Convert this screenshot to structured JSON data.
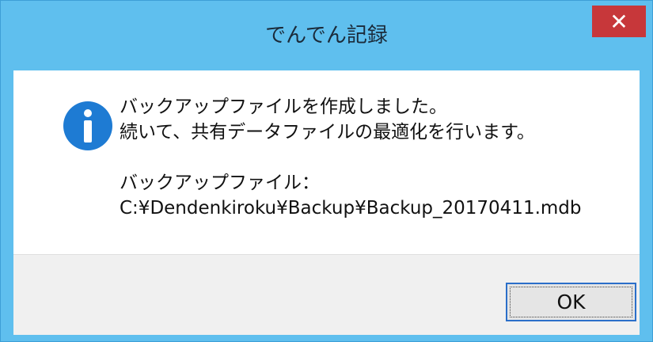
{
  "window": {
    "title": "でんでん記録",
    "close_label": "✕"
  },
  "message": {
    "line1": "バックアップファイルを作成しました。",
    "line2": "続いて、共有データファイルの最適化を行います。",
    "label": "バックアップファイル：",
    "path": " C:¥Dendenkiroku¥Backup¥Backup_20170411.mdb"
  },
  "icon": {
    "name": "info-icon",
    "color": "#1e7bd3"
  },
  "buttons": {
    "ok_label": "OK"
  },
  "colors": {
    "titlebar": "#5fbfee",
    "close": "#c7373a",
    "footer": "#f0f0f0",
    "focus_border": "#2b6fc9"
  }
}
